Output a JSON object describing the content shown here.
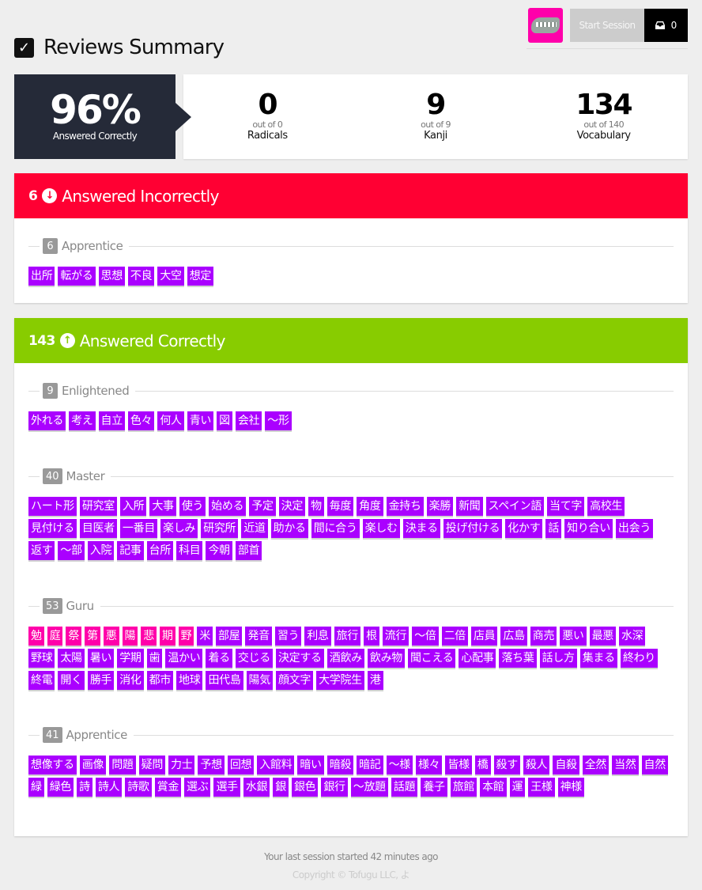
{
  "header": {
    "title": "Reviews Summary",
    "start_session": "Start Session",
    "inbox_count": "0",
    "avatar_icon": "alligator-avatar"
  },
  "stats": {
    "percent": "96%",
    "percent_label": "Answered Correctly",
    "radicals": {
      "value": "0",
      "out_of": "out of 0",
      "label": "Radicals"
    },
    "kanji": {
      "value": "9",
      "out_of": "out of 9",
      "label": "Kanji"
    },
    "vocabulary": {
      "value": "134",
      "out_of": "out of 140",
      "label": "Vocabulary"
    }
  },
  "incorrect": {
    "count": "6",
    "label": "Answered Incorrectly",
    "color": "#ff0033",
    "groups": [
      {
        "count": "6",
        "name": "Apprentice",
        "items": [
          {
            "t": "出所",
            "k": "vocab"
          },
          {
            "t": "転がる",
            "k": "vocab"
          },
          {
            "t": "思想",
            "k": "vocab"
          },
          {
            "t": "不良",
            "k": "vocab"
          },
          {
            "t": "大空",
            "k": "vocab"
          },
          {
            "t": "想定",
            "k": "vocab"
          }
        ]
      }
    ]
  },
  "correct": {
    "count": "143",
    "label": "Answered Correctly",
    "color": "#88cc00",
    "groups": [
      {
        "count": "9",
        "name": "Enlightened",
        "items": [
          {
            "t": "外れる",
            "k": "vocab"
          },
          {
            "t": "考え",
            "k": "vocab"
          },
          {
            "t": "自立",
            "k": "vocab"
          },
          {
            "t": "色々",
            "k": "vocab"
          },
          {
            "t": "何人",
            "k": "vocab"
          },
          {
            "t": "青い",
            "k": "vocab"
          },
          {
            "t": "図",
            "k": "vocab"
          },
          {
            "t": "会社",
            "k": "vocab"
          },
          {
            "t": "〜形",
            "k": "vocab"
          }
        ]
      },
      {
        "count": "40",
        "name": "Master",
        "items": [
          {
            "t": "ハート形",
            "k": "vocab"
          },
          {
            "t": "研究室",
            "k": "vocab"
          },
          {
            "t": "入所",
            "k": "vocab"
          },
          {
            "t": "大事",
            "k": "vocab"
          },
          {
            "t": "使う",
            "k": "vocab"
          },
          {
            "t": "始める",
            "k": "vocab"
          },
          {
            "t": "予定",
            "k": "vocab"
          },
          {
            "t": "決定",
            "k": "vocab"
          },
          {
            "t": "物",
            "k": "vocab"
          },
          {
            "t": "毎度",
            "k": "vocab"
          },
          {
            "t": "角度",
            "k": "vocab"
          },
          {
            "t": "金持ち",
            "k": "vocab"
          },
          {
            "t": "楽勝",
            "k": "vocab"
          },
          {
            "t": "新聞",
            "k": "vocab"
          },
          {
            "t": "スペイン語",
            "k": "vocab"
          },
          {
            "t": "当て字",
            "k": "vocab"
          },
          {
            "t": "高校生",
            "k": "vocab"
          },
          {
            "t": "見付ける",
            "k": "vocab"
          },
          {
            "t": "目医者",
            "k": "vocab"
          },
          {
            "t": "一番目",
            "k": "vocab"
          },
          {
            "t": "楽しみ",
            "k": "vocab"
          },
          {
            "t": "研究所",
            "k": "vocab"
          },
          {
            "t": "近道",
            "k": "vocab"
          },
          {
            "t": "助かる",
            "k": "vocab"
          },
          {
            "t": "間に合う",
            "k": "vocab"
          },
          {
            "t": "楽しむ",
            "k": "vocab"
          },
          {
            "t": "決まる",
            "k": "vocab"
          },
          {
            "t": "投げ付ける",
            "k": "vocab"
          },
          {
            "t": "化かす",
            "k": "vocab"
          },
          {
            "t": "話",
            "k": "vocab"
          },
          {
            "t": "知り合い",
            "k": "vocab"
          },
          {
            "t": "出会う",
            "k": "vocab"
          },
          {
            "t": "返す",
            "k": "vocab"
          },
          {
            "t": "〜部",
            "k": "vocab"
          },
          {
            "t": "入院",
            "k": "vocab"
          },
          {
            "t": "記事",
            "k": "vocab"
          },
          {
            "t": "台所",
            "k": "vocab"
          },
          {
            "t": "科目",
            "k": "vocab"
          },
          {
            "t": "今朝",
            "k": "vocab"
          },
          {
            "t": "部首",
            "k": "vocab"
          }
        ]
      },
      {
        "count": "53",
        "name": "Guru",
        "items": [
          {
            "t": "勉",
            "k": "kanji"
          },
          {
            "t": "庭",
            "k": "kanji"
          },
          {
            "t": "祭",
            "k": "kanji"
          },
          {
            "t": "第",
            "k": "kanji"
          },
          {
            "t": "悪",
            "k": "kanji"
          },
          {
            "t": "陽",
            "k": "kanji"
          },
          {
            "t": "悲",
            "k": "kanji"
          },
          {
            "t": "期",
            "k": "kanji"
          },
          {
            "t": "野",
            "k": "kanji"
          },
          {
            "t": "米",
            "k": "vocab"
          },
          {
            "t": "部屋",
            "k": "vocab"
          },
          {
            "t": "発音",
            "k": "vocab"
          },
          {
            "t": "習う",
            "k": "vocab"
          },
          {
            "t": "利息",
            "k": "vocab"
          },
          {
            "t": "旅行",
            "k": "vocab"
          },
          {
            "t": "根",
            "k": "vocab"
          },
          {
            "t": "流行",
            "k": "vocab"
          },
          {
            "t": "〜倍",
            "k": "vocab"
          },
          {
            "t": "二倍",
            "k": "vocab"
          },
          {
            "t": "店員",
            "k": "vocab"
          },
          {
            "t": "広島",
            "k": "vocab"
          },
          {
            "t": "商売",
            "k": "vocab"
          },
          {
            "t": "悪い",
            "k": "vocab"
          },
          {
            "t": "最悪",
            "k": "vocab"
          },
          {
            "t": "水深",
            "k": "vocab"
          },
          {
            "t": "野球",
            "k": "vocab"
          },
          {
            "t": "太陽",
            "k": "vocab"
          },
          {
            "t": "暑い",
            "k": "vocab"
          },
          {
            "t": "学期",
            "k": "vocab"
          },
          {
            "t": "歯",
            "k": "vocab"
          },
          {
            "t": "温かい",
            "k": "vocab"
          },
          {
            "t": "着る",
            "k": "vocab"
          },
          {
            "t": "交じる",
            "k": "vocab"
          },
          {
            "t": "決定する",
            "k": "vocab"
          },
          {
            "t": "酒飲み",
            "k": "vocab"
          },
          {
            "t": "飲み物",
            "k": "vocab"
          },
          {
            "t": "聞こえる",
            "k": "vocab"
          },
          {
            "t": "心配事",
            "k": "vocab"
          },
          {
            "t": "落ち葉",
            "k": "vocab"
          },
          {
            "t": "話し方",
            "k": "vocab"
          },
          {
            "t": "集まる",
            "k": "vocab"
          },
          {
            "t": "終わり",
            "k": "vocab"
          },
          {
            "t": "終電",
            "k": "vocab"
          },
          {
            "t": "開く",
            "k": "vocab"
          },
          {
            "t": "勝手",
            "k": "vocab"
          },
          {
            "t": "消化",
            "k": "vocab"
          },
          {
            "t": "都市",
            "k": "vocab"
          },
          {
            "t": "地球",
            "k": "vocab"
          },
          {
            "t": "田代島",
            "k": "vocab"
          },
          {
            "t": "陽気",
            "k": "vocab"
          },
          {
            "t": "顔文字",
            "k": "vocab"
          },
          {
            "t": "大学院生",
            "k": "vocab"
          },
          {
            "t": "港",
            "k": "vocab"
          }
        ]
      },
      {
        "count": "41",
        "name": "Apprentice",
        "items": [
          {
            "t": "想像する",
            "k": "vocab"
          },
          {
            "t": "画像",
            "k": "vocab"
          },
          {
            "t": "問題",
            "k": "vocab"
          },
          {
            "t": "疑問",
            "k": "vocab"
          },
          {
            "t": "力士",
            "k": "vocab"
          },
          {
            "t": "予想",
            "k": "vocab"
          },
          {
            "t": "回想",
            "k": "vocab"
          },
          {
            "t": "入館料",
            "k": "vocab"
          },
          {
            "t": "暗い",
            "k": "vocab"
          },
          {
            "t": "暗殺",
            "k": "vocab"
          },
          {
            "t": "暗記",
            "k": "vocab"
          },
          {
            "t": "〜様",
            "k": "vocab"
          },
          {
            "t": "様々",
            "k": "vocab"
          },
          {
            "t": "皆様",
            "k": "vocab"
          },
          {
            "t": "橋",
            "k": "vocab"
          },
          {
            "t": "殺す",
            "k": "vocab"
          },
          {
            "t": "殺人",
            "k": "vocab"
          },
          {
            "t": "自殺",
            "k": "vocab"
          },
          {
            "t": "全然",
            "k": "vocab"
          },
          {
            "t": "当然",
            "k": "vocab"
          },
          {
            "t": "自然",
            "k": "vocab"
          },
          {
            "t": "緑",
            "k": "vocab"
          },
          {
            "t": "緑色",
            "k": "vocab"
          },
          {
            "t": "詩",
            "k": "vocab"
          },
          {
            "t": "詩人",
            "k": "vocab"
          },
          {
            "t": "詩歌",
            "k": "vocab"
          },
          {
            "t": "賞金",
            "k": "vocab"
          },
          {
            "t": "選ぶ",
            "k": "vocab"
          },
          {
            "t": "選手",
            "k": "vocab"
          },
          {
            "t": "水銀",
            "k": "vocab"
          },
          {
            "t": "銀",
            "k": "vocab"
          },
          {
            "t": "銀色",
            "k": "vocab"
          },
          {
            "t": "銀行",
            "k": "vocab"
          },
          {
            "t": "〜放題",
            "k": "vocab"
          },
          {
            "t": "話題",
            "k": "vocab"
          },
          {
            "t": "養子",
            "k": "vocab"
          },
          {
            "t": "旅館",
            "k": "vocab"
          },
          {
            "t": "本館",
            "k": "vocab"
          },
          {
            "t": "運",
            "k": "vocab"
          },
          {
            "t": "王様",
            "k": "vocab"
          },
          {
            "t": "神様",
            "k": "vocab"
          }
        ]
      }
    ]
  },
  "colors": {
    "vocab": "#aa00ff",
    "kanji": "#ff00aa",
    "dark": "#252a38"
  },
  "footer": {
    "last_session": "Your last session started 42 minutes ago",
    "copyright": "Copyright © Tofugu LLC, よ"
  }
}
